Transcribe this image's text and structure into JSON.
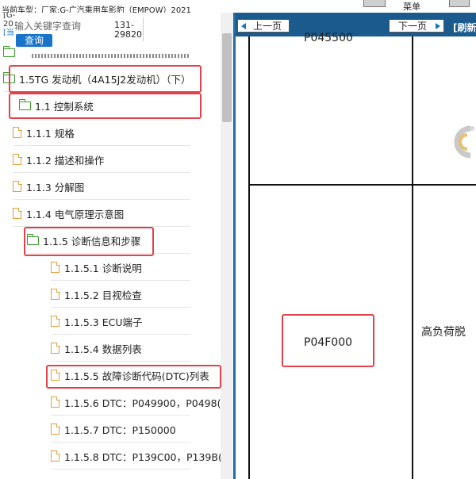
{
  "header": {
    "car_info": "当前车型：厂家:G-广汽乘用车影豹（EMPOW）2021",
    "menu_label": "菜单"
  },
  "sidebar": {
    "fragments": [
      "[G-",
      "20",
      "[当"
    ],
    "search": {
      "placeholder": "输入关键字查询",
      "button_label": "查询",
      "code_range": "131-29820"
    },
    "tree": [
      {
        "label": "1.5TG 发动机（4A15J2发动机）（下）",
        "icon": "folder-open-icon",
        "level": 0,
        "highlighted": true
      },
      {
        "label": "1.1 控制系统",
        "icon": "folder-open-icon",
        "level": 1,
        "highlighted": true
      },
      {
        "label": "1.1.1 规格",
        "icon": "document-icon",
        "level": 1,
        "highlighted": false
      },
      {
        "label": "1.1.2 描述和操作",
        "icon": "document-icon",
        "level": 1,
        "highlighted": false
      },
      {
        "label": "1.1.3 分解图",
        "icon": "document-icon",
        "level": 1,
        "highlighted": false
      },
      {
        "label": "1.1.4 电气原理示意图",
        "icon": "document-icon",
        "level": 1,
        "highlighted": false
      },
      {
        "label": "1.1.5 诊断信息和步骤",
        "icon": "folder-open-icon",
        "level": 2,
        "highlighted": true
      },
      {
        "label": "1.1.5.1 诊断说明",
        "icon": "document-icon",
        "level": 3,
        "highlighted": false
      },
      {
        "label": "1.1.5.2 目视检查",
        "icon": "document-icon",
        "level": 3,
        "highlighted": false
      },
      {
        "label": "1.1.5.3 ECU端子",
        "icon": "document-icon",
        "level": 3,
        "highlighted": false
      },
      {
        "label": "1.1.5.4 数据列表",
        "icon": "document-icon",
        "level": 3,
        "highlighted": false
      },
      {
        "label": "1.1.5.5 故障诊断代码(DTC)列表",
        "icon": "document-icon",
        "level": 3,
        "highlighted": true
      },
      {
        "label": "1.1.5.6 DTC：P049900，P0498(",
        "icon": "document-icon",
        "level": 3,
        "highlighted": false
      },
      {
        "label": "1.1.5.7 DTC：P150000",
        "icon": "document-icon",
        "level": 3,
        "highlighted": false
      },
      {
        "label": "1.1.5.8 DTC：P139C00，P139B(",
        "icon": "document-icon",
        "level": 3,
        "highlighted": false
      }
    ]
  },
  "content": {
    "nav": {
      "prev_label": "上一页",
      "next_label": "下一页",
      "refresh_label": "[刷新"
    },
    "table": {
      "row1_code": "P045500",
      "row2_code": "P04F000",
      "row2_desc": "高负荷脱"
    }
  },
  "colors": {
    "highlight": "#e0424b",
    "nav_bar": "#1a5a8c",
    "search_button": "#1773c8",
    "folder_icon": "#3a9a2e",
    "document_icon": "#e0a040"
  }
}
